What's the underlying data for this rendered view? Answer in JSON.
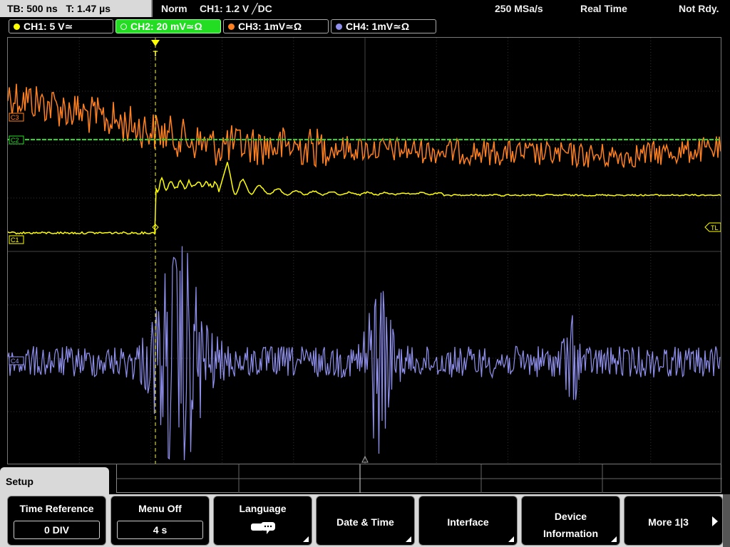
{
  "status": {
    "timebase": "TB: 500 ns",
    "trigger_pos": "T: 1.47 µs",
    "mode": "Norm",
    "trigger_source": "CH1: 1.2 V ╱DC",
    "sample_rate": "250 MSa/s",
    "acq_mode": "Real Time",
    "state": "Not Rdy."
  },
  "channels": [
    {
      "label": "CH1: 5 V≃",
      "color": "#ffff00",
      "active": false
    },
    {
      "label": "CH2: 20 mV≃Ω",
      "color": "#22dd22",
      "active": true
    },
    {
      "label": "CH3: 1mV≃Ω",
      "color": "#ff8020",
      "active": false
    },
    {
      "label": "CH4: 1mV≃Ω",
      "color": "#9090ee",
      "active": false
    }
  ],
  "markers": {
    "c1": "C1",
    "c2": "C2",
    "c3": "C3",
    "c4": "C4",
    "tl": "TL",
    "trig": "T"
  },
  "menu": {
    "title": "Setup",
    "keys": [
      {
        "label": "Time Reference",
        "value": "0 DIV"
      },
      {
        "label": "Menu Off",
        "value": "4 s"
      },
      {
        "label": "Language",
        "icon": "speech-bubble-icon"
      },
      {
        "label": "Date & Time"
      },
      {
        "label": "Interface"
      },
      {
        "label": "Device Information"
      },
      {
        "label": "More 1|3"
      }
    ]
  }
}
